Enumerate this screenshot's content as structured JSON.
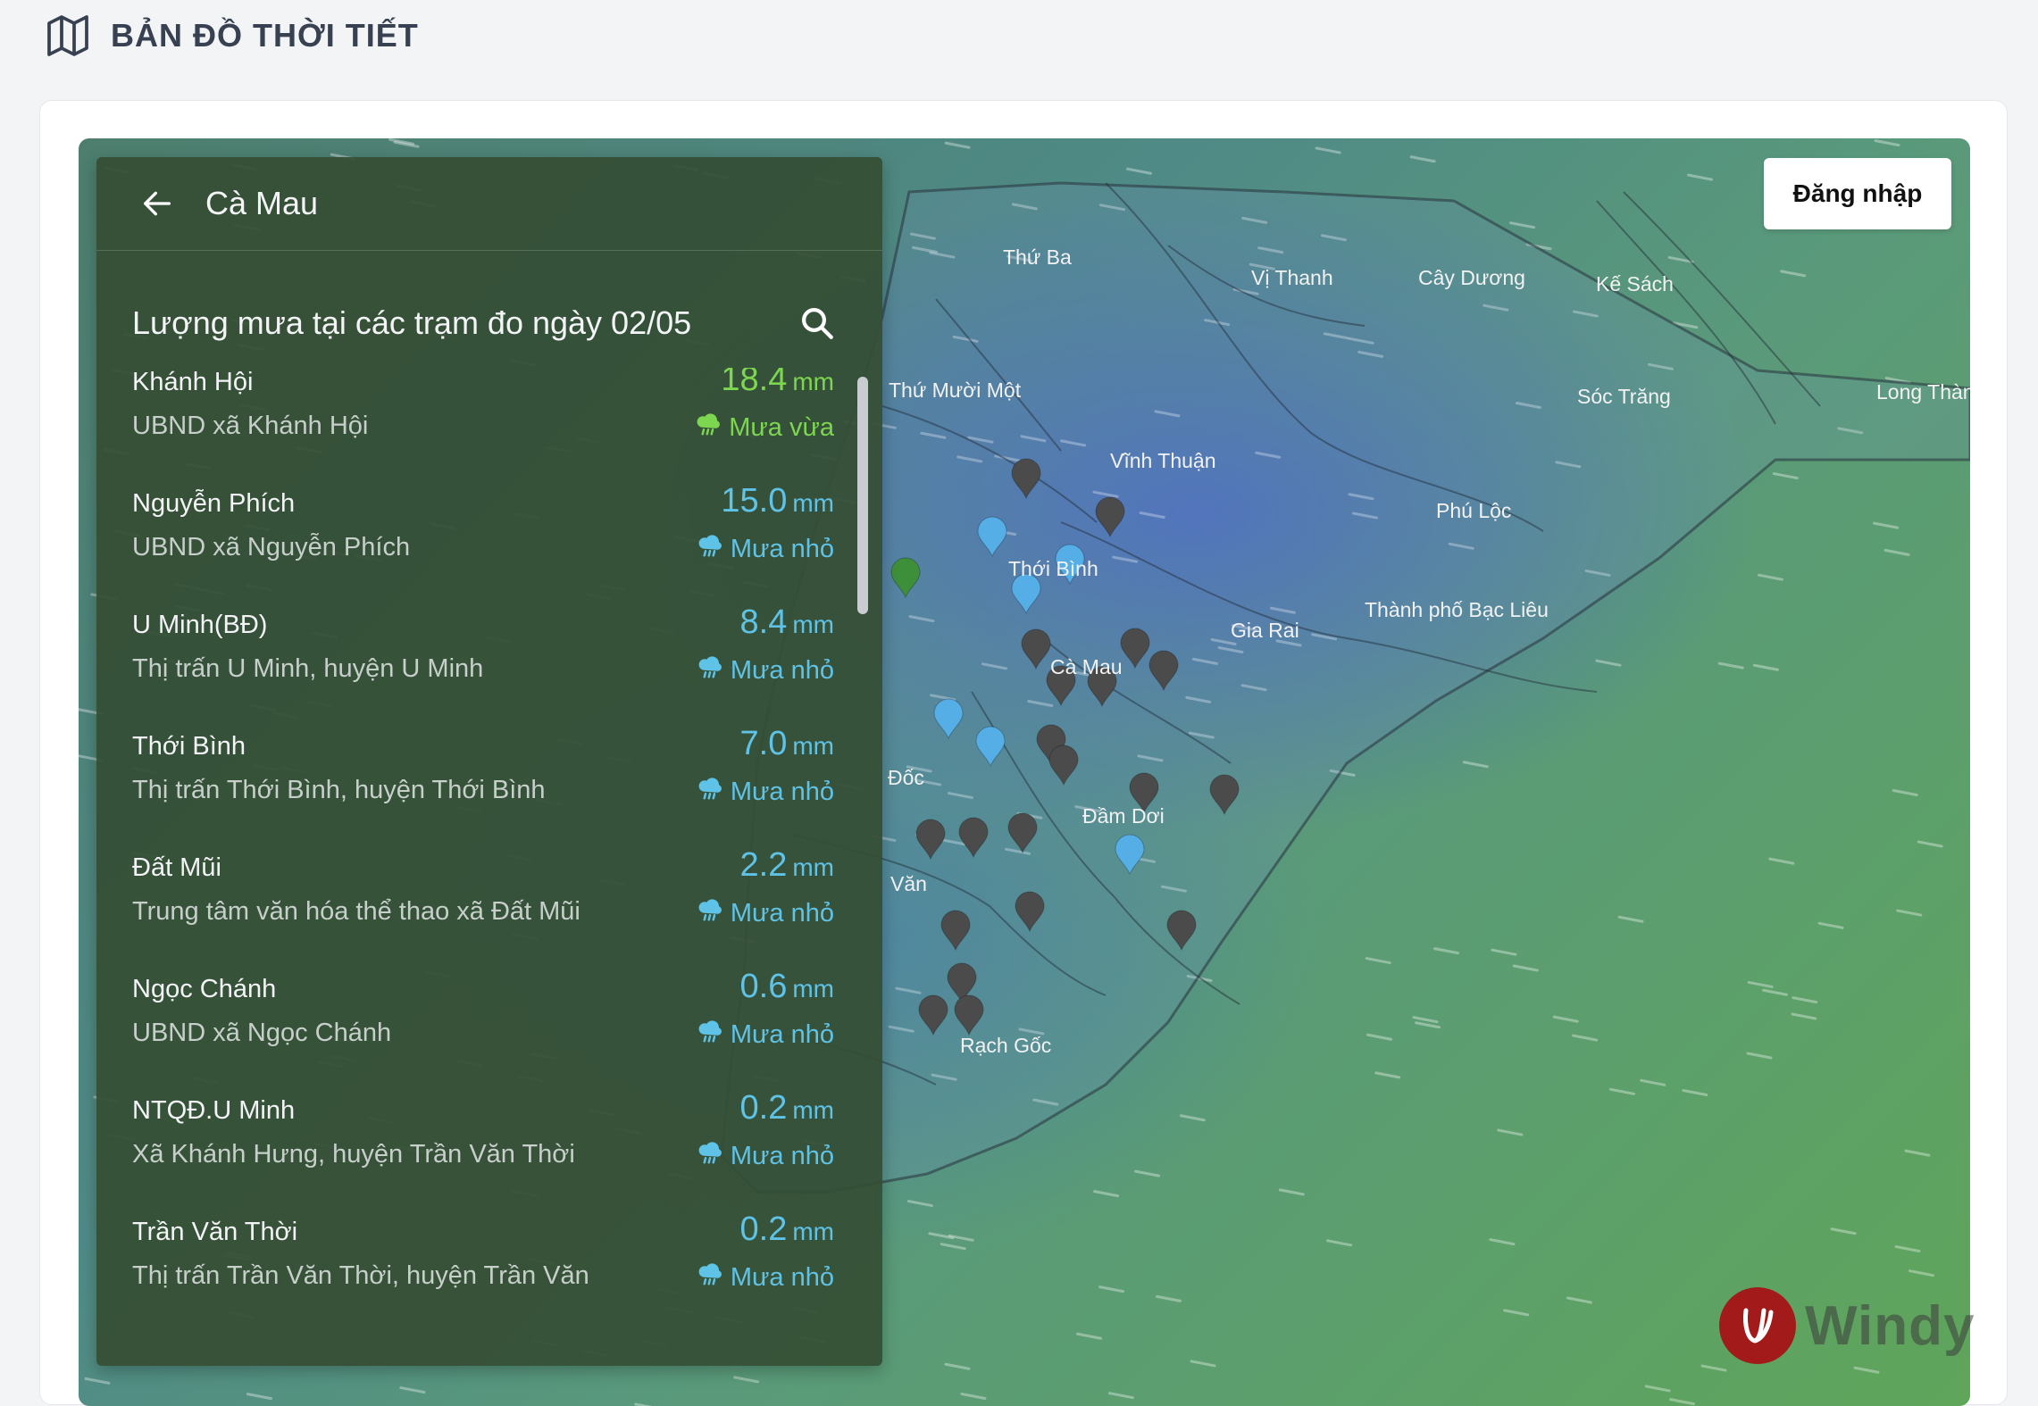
{
  "header": {
    "title": "BẢN ĐỒ THỜI TIẾT",
    "icon": "map-icon"
  },
  "panel": {
    "region": "Cà Mau",
    "subtitle": "Lượng mưa tại các trạm đo ngày 02/05",
    "unit": "mm",
    "stations": [
      {
        "name": "Khánh Hội",
        "address": "UBND xã Khánh Hội",
        "value": "18.4",
        "status": "Mưa vừa",
        "level": "moderate"
      },
      {
        "name": "Nguyễn Phích",
        "address": "UBND xã Nguyễn Phích",
        "value": "15.0",
        "status": "Mưa nhỏ",
        "level": "light"
      },
      {
        "name": "U Minh(BĐ)",
        "address": "Thị trấn U Minh, huyện U Minh",
        "value": "8.4",
        "status": "Mưa nhỏ",
        "level": "light"
      },
      {
        "name": "Thới Bình",
        "address": "Thị trấn Thới Bình, huyện Thới Bình",
        "value": "7.0",
        "status": "Mưa nhỏ",
        "level": "light"
      },
      {
        "name": "Đất Mũi",
        "address": "Trung tâm văn hóa thể thao xã Đất Mũi",
        "value": "2.2",
        "status": "Mưa nhỏ",
        "level": "light"
      },
      {
        "name": "Ngọc Chánh",
        "address": "UBND xã Ngọc Chánh",
        "value": "0.6",
        "status": "Mưa nhỏ",
        "level": "light"
      },
      {
        "name": "NTQĐ.U Minh",
        "address": "Xã Khánh Hưng, huyện Trần Văn Thời",
        "value": "0.2",
        "status": "Mưa nhỏ",
        "level": "light"
      },
      {
        "name": "Trần Văn Thời",
        "address": "Thị trấn Trần Văn Thời, huyện Trần Văn",
        "value": "0.2",
        "status": "Mưa nhỏ",
        "level": "light"
      }
    ]
  },
  "map": {
    "labels": [
      "Thứ Ba",
      "Vị Thanh",
      "Cây Dương",
      "Kế Sách",
      "Thứ Mười Một",
      "Sóc Trăng",
      "Long Thàn",
      "Vĩnh Thuận",
      "Phú Lộc",
      "Thới Bình",
      "Thành phố Bạc Liêu",
      "Gia Rai",
      "Cà Mau",
      "Đốc",
      "Đầm Dơi",
      "Văn",
      "Rạch Gốc"
    ],
    "marker_colors": {
      "dark": "#4b4b4b",
      "blue": "#55aee6",
      "green": "#3e8f3a"
    },
    "login_label": "Đăng nhập",
    "attribution": "Windy"
  },
  "colors": {
    "light_rain": "#5fc3e8",
    "moderate_rain": "#7dd64f"
  }
}
